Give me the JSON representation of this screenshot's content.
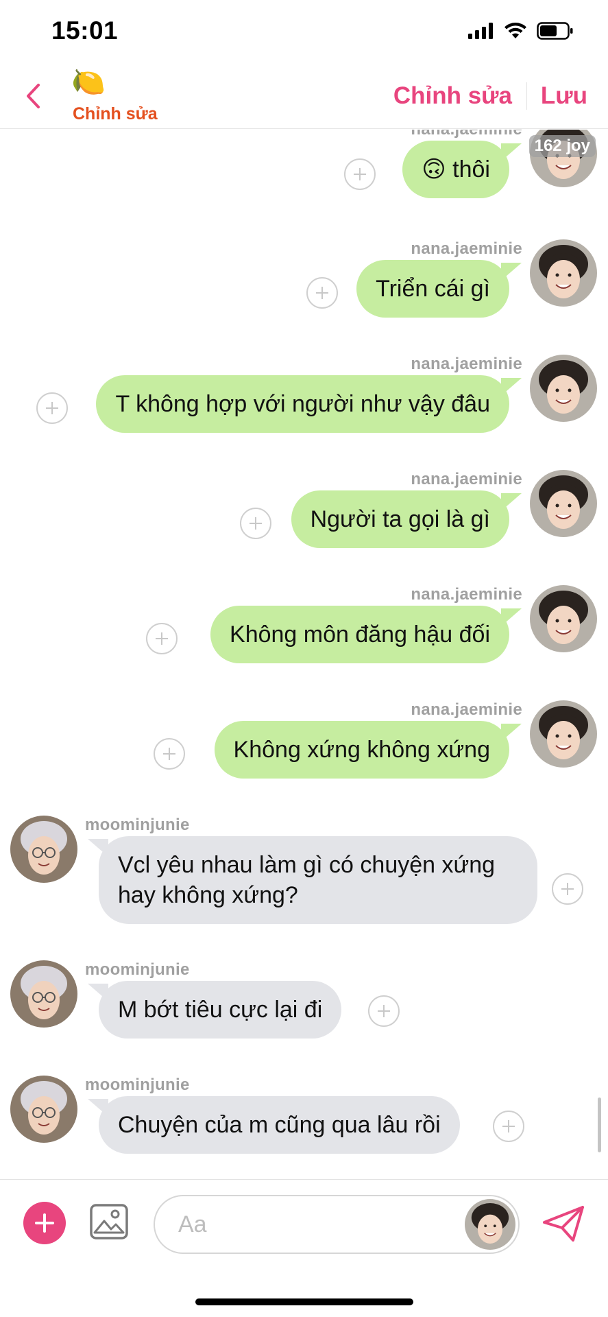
{
  "status_bar": {
    "time": "15:01"
  },
  "header": {
    "emoji": "🍋",
    "subtitle": "Chỉnh sửa",
    "edit_label": "Chỉnh sửa",
    "save_label": "Lưu",
    "back_icon": "chevron-left-icon"
  },
  "chat": {
    "joy_badge": "162 joy",
    "messages": [
      {
        "sender": "nana.jaeminie",
        "side": "mine",
        "text": "🙃 thôi"
      },
      {
        "sender": "nana.jaeminie",
        "side": "mine",
        "text": "Triển cái gì"
      },
      {
        "sender": "nana.jaeminie",
        "side": "mine",
        "text": "T không hợp với người như vậy đâu"
      },
      {
        "sender": "nana.jaeminie",
        "side": "mine",
        "text": "Người ta gọi là gì"
      },
      {
        "sender": "nana.jaeminie",
        "side": "mine",
        "text": "Không môn đăng hậu đối"
      },
      {
        "sender": "nana.jaeminie",
        "side": "mine",
        "text": "Không xứng không xứng"
      },
      {
        "sender": "moominjunie",
        "side": "theirs",
        "text": "Vcl yêu nhau làm gì có chuyện xứng hay không xứng?"
      },
      {
        "sender": "moominjunie",
        "side": "theirs",
        "text": "M bớt tiêu cực lại đi"
      },
      {
        "sender": "moominjunie",
        "side": "theirs",
        "text": "Chuyện của m cũng qua lâu rồi"
      }
    ]
  },
  "composer": {
    "placeholder": "Aa",
    "add_icon": "plus-icon",
    "image_icon": "image-icon",
    "send_icon": "send-icon"
  },
  "colors": {
    "accent": "#e8457e",
    "subtitle": "#e4501f",
    "my_bubble": "#c6eda0",
    "their_bubble": "#e3e4e8",
    "username": "#a0a0a0"
  }
}
